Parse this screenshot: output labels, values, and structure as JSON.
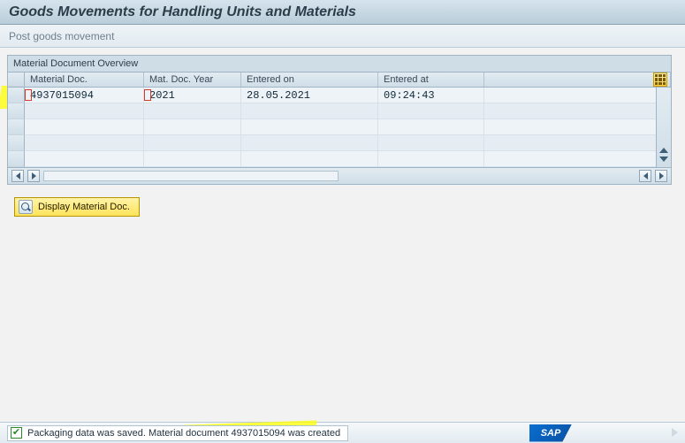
{
  "title": "Goods Movements for Handling Units and Materials",
  "subheader": "Post goods movement",
  "panel_title": "Material Document Overview",
  "columns": {
    "mdoc": "Material Doc.",
    "year": "Mat. Doc. Year",
    "date": "Entered on",
    "time": "Entered at"
  },
  "rows": [
    {
      "mdoc": "4937015094",
      "year": "2021",
      "date": "28.05.2021",
      "time": "09:24:43"
    }
  ],
  "display_btn": "Display Material Doc.",
  "status_message": "Packaging data was saved. Material document 4937015094 was created",
  "sap_logo_text": "SAP"
}
